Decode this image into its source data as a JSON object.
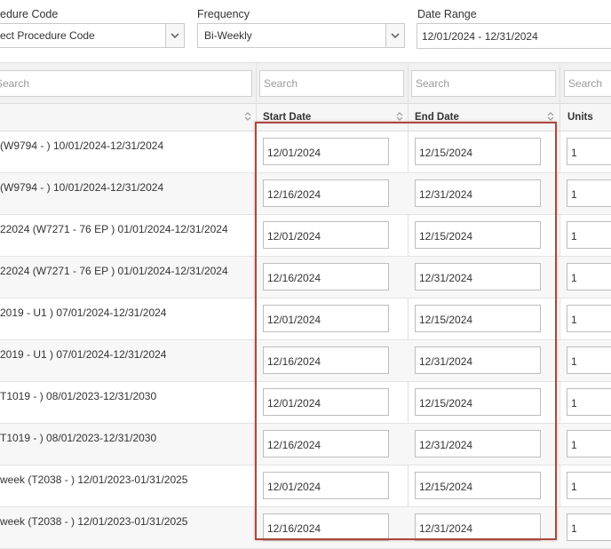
{
  "filters": {
    "procedure_code": {
      "label": "edure Code",
      "value": "ect Procedure Code"
    },
    "frequency": {
      "label": "Frequency",
      "value": "Bi-Weekly"
    },
    "date_range": {
      "label": "Date Range",
      "value": "12/01/2024 - 12/31/2024"
    }
  },
  "search": {
    "placeholder": "Search"
  },
  "columns": {
    "start_date": "Start Date",
    "end_date": "End Date",
    "units": "Units"
  },
  "rows": [
    {
      "description": "(W9794 - ) 10/01/2024-12/31/2024",
      "start": "12/01/2024",
      "end": "12/15/2024",
      "units": "1"
    },
    {
      "description": "(W9794 - ) 10/01/2024-12/31/2024",
      "start": "12/16/2024",
      "end": "12/31/2024",
      "units": "1"
    },
    {
      "description": "22024 (W7271 - 76 EP ) 01/01/2024-12/31/2024",
      "start": "12/01/2024",
      "end": "12/15/2024",
      "units": "1"
    },
    {
      "description": "22024 (W7271 - 76 EP ) 01/01/2024-12/31/2024",
      "start": "12/16/2024",
      "end": "12/31/2024",
      "units": "1"
    },
    {
      "description": "2019 - U1 ) 07/01/2024-12/31/2024",
      "start": "12/01/2024",
      "end": "12/15/2024",
      "units": "1"
    },
    {
      "description": "2019 - U1 ) 07/01/2024-12/31/2024",
      "start": "12/16/2024",
      "end": "12/31/2024",
      "units": "1"
    },
    {
      "description": "T1019 - ) 08/01/2023-12/31/2030",
      "start": "12/01/2024",
      "end": "12/15/2024",
      "units": "1"
    },
    {
      "description": "T1019 - ) 08/01/2023-12/31/2030",
      "start": "12/16/2024",
      "end": "12/31/2024",
      "units": "1"
    },
    {
      "description": "week (T2038 - ) 12/01/2023-01/31/2025",
      "start": "12/01/2024",
      "end": "12/15/2024",
      "units": "1"
    },
    {
      "description": "week (T2038 - ) 12/01/2023-01/31/2025",
      "start": "12/16/2024",
      "end": "12/31/2024",
      "units": "1"
    }
  ],
  "colors": {
    "highlight_border": "#a84a3c",
    "header_bg": "#f6f6f6",
    "filter_bg": "#f1f1f1"
  }
}
